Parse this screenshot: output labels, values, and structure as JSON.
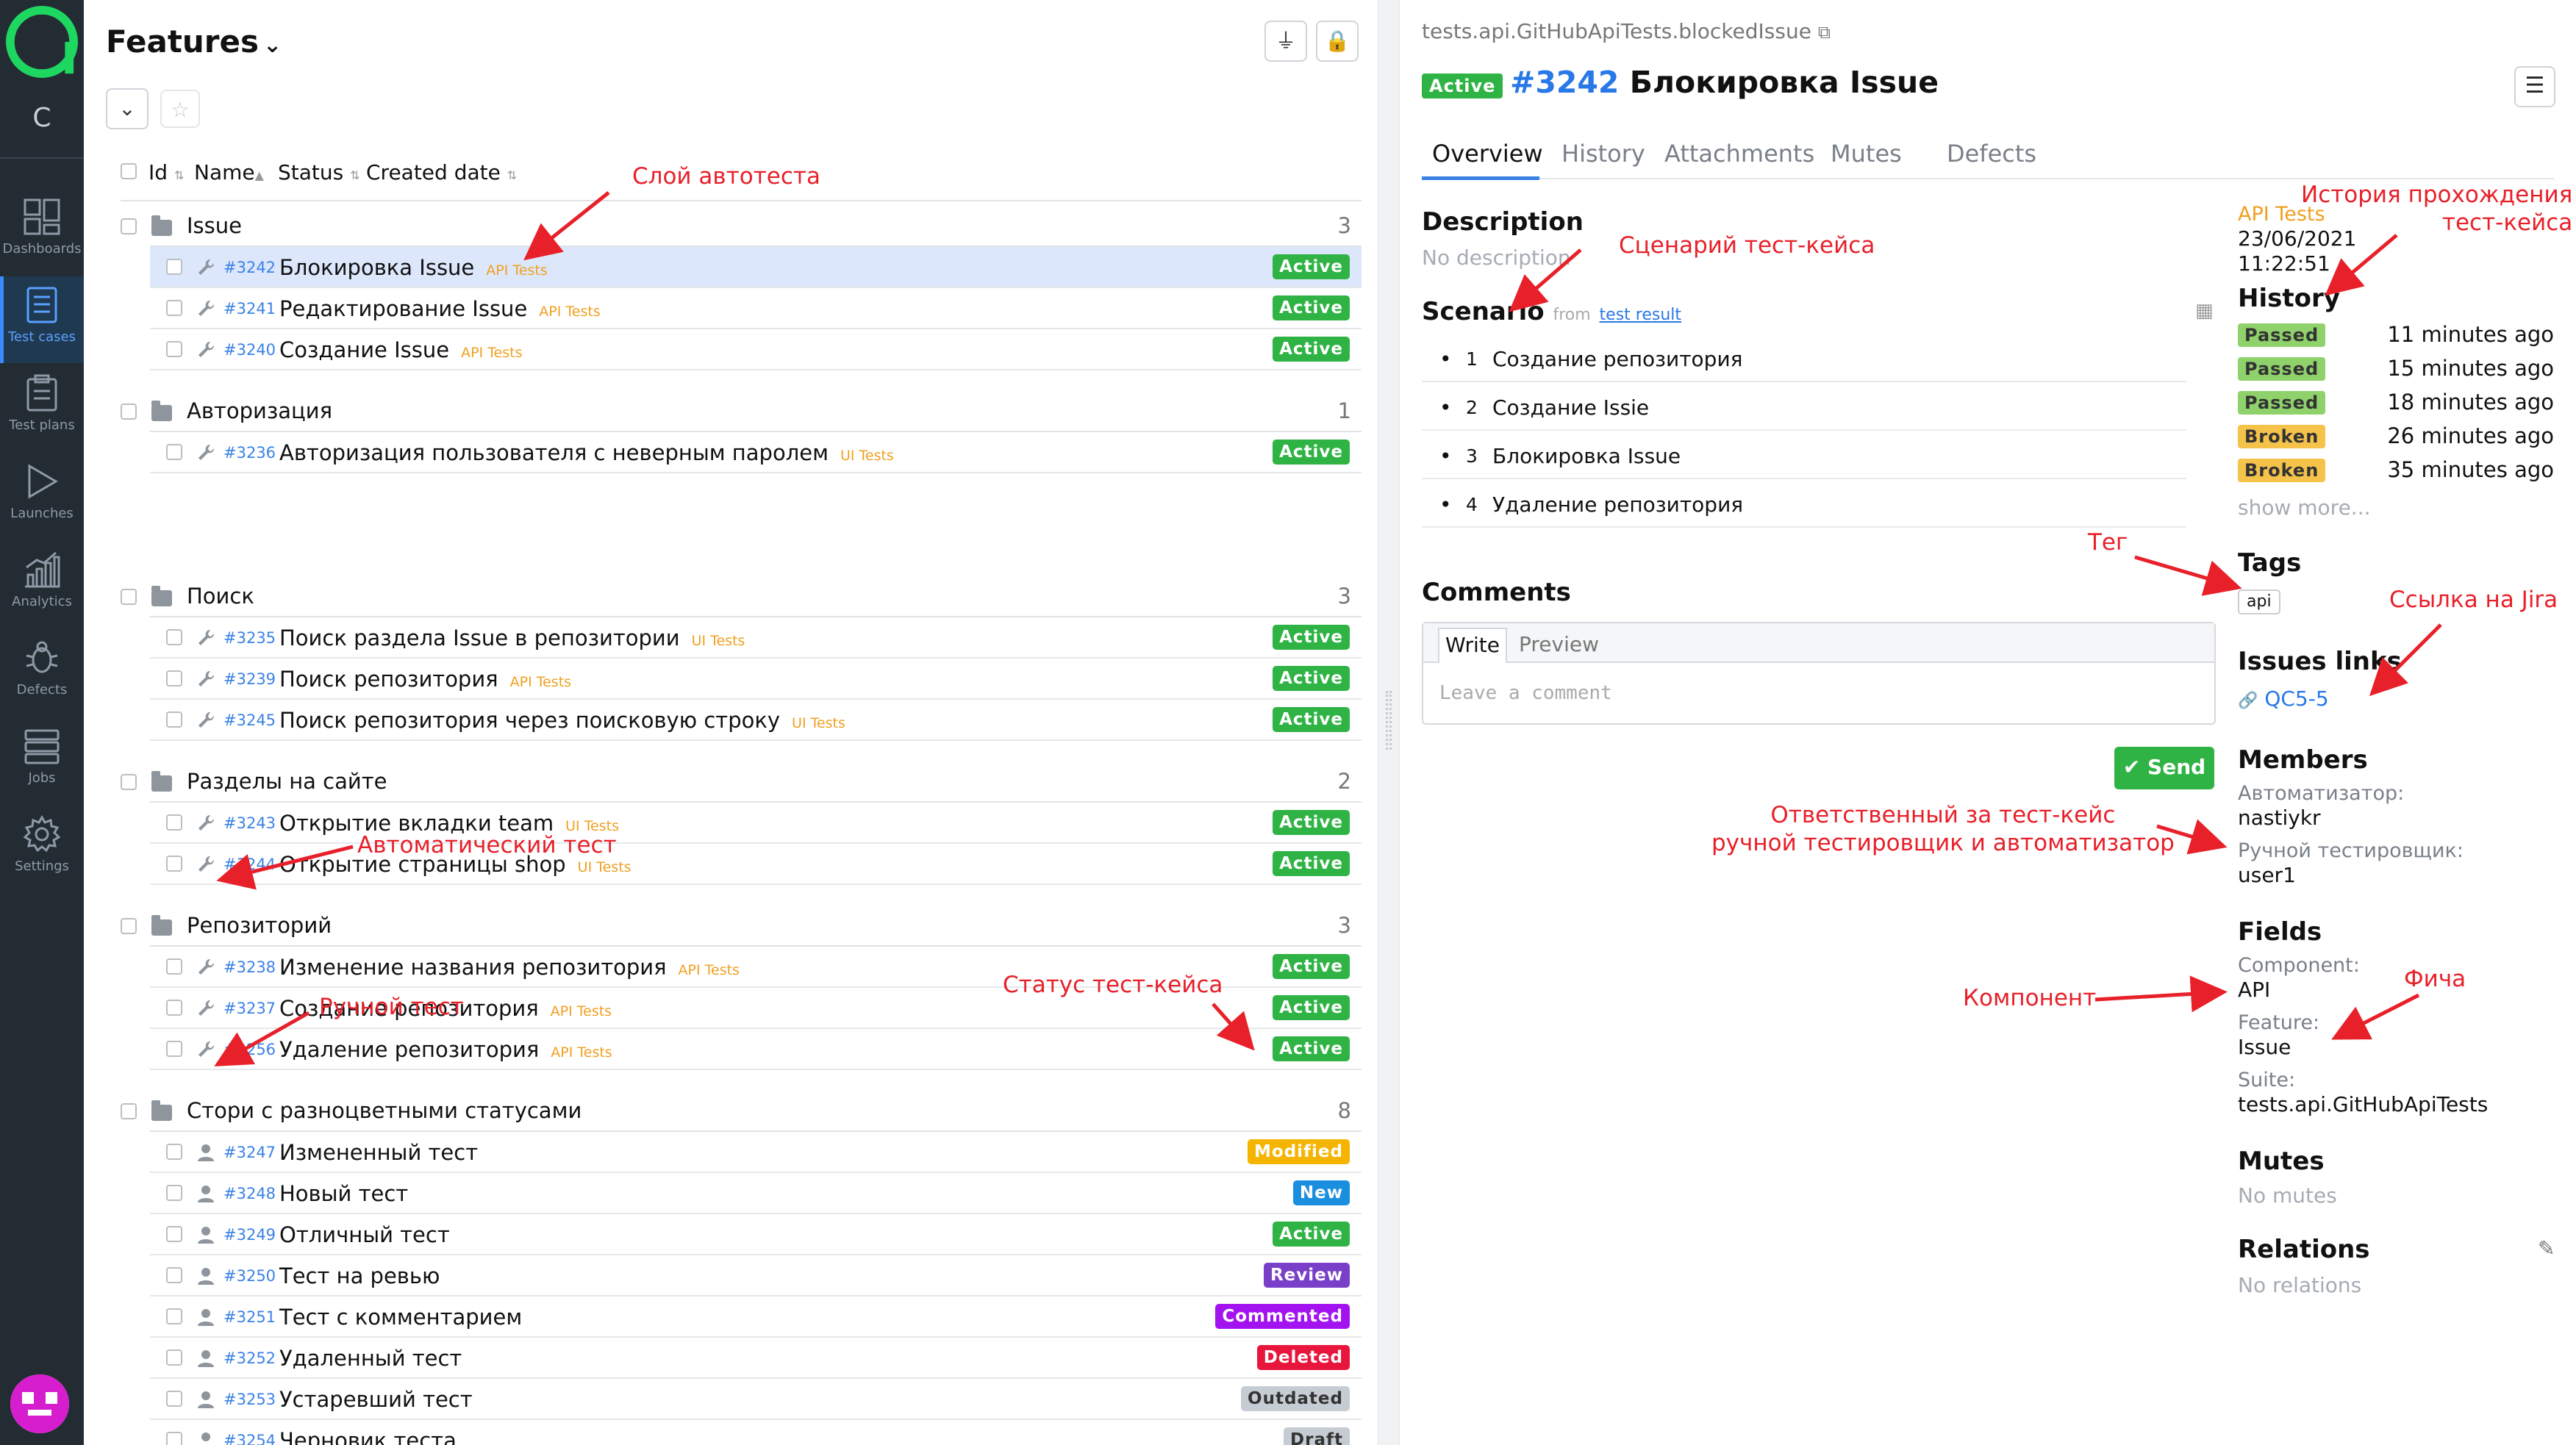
{
  "sidebar": {
    "project_letter": "C",
    "nav": [
      {
        "label": "Dashboards",
        "icon": "dashboards-icon",
        "active": false
      },
      {
        "label": "Test cases",
        "icon": "test-cases-icon",
        "active": true
      },
      {
        "label": "Test plans",
        "icon": "test-plans-icon",
        "active": false
      },
      {
        "label": "Launches",
        "icon": "launches-icon",
        "active": false
      },
      {
        "label": "Analytics",
        "icon": "analytics-icon",
        "active": false
      },
      {
        "label": "Defects",
        "icon": "defects-icon",
        "active": false
      },
      {
        "label": "Jobs",
        "icon": "jobs-icon",
        "active": false
      },
      {
        "label": "Settings",
        "icon": "settings-icon",
        "active": false
      }
    ]
  },
  "left": {
    "title": "Features",
    "columns": [
      "Id",
      "Name",
      "Status",
      "Created date"
    ],
    "groups": [
      {
        "name": "Issue",
        "count": "3",
        "rows": [
          {
            "id": "#3242",
            "name": "Блокировка Issue",
            "layer": "API Tests",
            "status": "Active",
            "type": "auto",
            "selected": true
          },
          {
            "id": "#3241",
            "name": "Редактирование Issue",
            "layer": "API Tests",
            "status": "Active",
            "type": "auto"
          },
          {
            "id": "#3240",
            "name": "Создание Issue",
            "layer": "API Tests",
            "status": "Active",
            "type": "auto"
          }
        ]
      },
      {
        "name": "Авторизация",
        "count": "1",
        "rows": [
          {
            "id": "#3236",
            "name": "Авторизация пользователя с неверным паролем",
            "layer": "UI Tests",
            "status": "Active",
            "type": "auto"
          }
        ]
      },
      {
        "name": "Поиск",
        "count": "3",
        "rows": [
          {
            "id": "#3235",
            "name": "Поиск раздела Issue в репозитории",
            "layer": "UI Tests",
            "status": "Active",
            "type": "auto"
          },
          {
            "id": "#3239",
            "name": "Поиск репозитория",
            "layer": "API Tests",
            "status": "Active",
            "type": "auto"
          },
          {
            "id": "#3245",
            "name": "Поиск репозитория через поисковую строку",
            "layer": "UI Tests",
            "status": "Active",
            "type": "auto"
          }
        ]
      },
      {
        "name": "Разделы на сайте",
        "count": "2",
        "rows": [
          {
            "id": "#3243",
            "name": "Открытие вкладки team",
            "layer": "UI Tests",
            "status": "Active",
            "type": "auto"
          },
          {
            "id": "#3244",
            "name": "Открытие страницы shop",
            "layer": "UI Tests",
            "status": "Active",
            "type": "auto"
          }
        ]
      },
      {
        "name": "Репозиторий",
        "count": "3",
        "rows": [
          {
            "id": "#3238",
            "name": "Изменение названия репозитория",
            "layer": "API Tests",
            "status": "Active",
            "type": "auto"
          },
          {
            "id": "#3237",
            "name": "Создание репозитория",
            "layer": "API Tests",
            "status": "Active",
            "type": "auto"
          },
          {
            "id": "#3256",
            "name": "Удаление репозитория",
            "layer": "API Tests",
            "status": "Active",
            "type": "auto"
          }
        ]
      },
      {
        "name": "Стори с разноцветными статусами",
        "count": "8",
        "rows": [
          {
            "id": "#3247",
            "name": "Измененный тест",
            "layer": "",
            "status": "Modified",
            "type": "manual"
          },
          {
            "id": "#3248",
            "name": "Новый тест",
            "layer": "",
            "status": "New",
            "type": "manual"
          },
          {
            "id": "#3249",
            "name": "Отличный тест",
            "layer": "",
            "status": "Active",
            "type": "manual"
          },
          {
            "id": "#3250",
            "name": "Тест на ревью",
            "layer": "",
            "status": "Review",
            "type": "manual"
          },
          {
            "id": "#3251",
            "name": "Тест с комментарием",
            "layer": "",
            "status": "Commented",
            "type": "manual"
          },
          {
            "id": "#3252",
            "name": "Удаленный тест",
            "layer": "",
            "status": "Deleted",
            "type": "manual"
          },
          {
            "id": "#3253",
            "name": "Устаревший тест",
            "layer": "",
            "status": "Outdated",
            "type": "manual"
          },
          {
            "id": "#3254",
            "name": "Черновик теста",
            "layer": "",
            "status": "Draft",
            "type": "manual"
          }
        ]
      }
    ]
  },
  "status_colors": {
    "Active": "#2fb344",
    "Modified": "#f5b400",
    "New": "#1a8fe0",
    "Review": "#7a3fc8",
    "Commented": "#a313f0",
    "Deleted": "#e8163c",
    "Outdated": "#c5ccd3",
    "Draft": "#c5ccd3"
  },
  "detail": {
    "full_name": "tests.api.GitHubApiTests.blockedIssue",
    "status": "Active",
    "id": "#3242",
    "name": "Блокировка Issue",
    "tabs": [
      "Overview",
      "History",
      "Attachments",
      "Mutes",
      "Defects"
    ],
    "description_title": "Description",
    "description_value": "No description",
    "scenario_title": "Scenario",
    "scenario_from": "from",
    "scenario_link": "test result",
    "steps": [
      {
        "num": "1",
        "text": "Создание репозитория"
      },
      {
        "num": "2",
        "text": "Создание Issie"
      },
      {
        "num": "3",
        "text": "Блокировка Issue"
      },
      {
        "num": "4",
        "text": "Удаление репозитория"
      }
    ],
    "comments_title": "Comments",
    "comment_write": "Write",
    "comment_preview": "Preview",
    "comment_placeholder": "Leave a comment",
    "send_label": "Send",
    "last_layer": "API Tests",
    "last_date": "23/06/2021",
    "last_time": "11:22:51",
    "history_title": "History",
    "history": [
      {
        "status": "Passed",
        "time": "11 minutes ago"
      },
      {
        "status": "Passed",
        "time": "15 minutes ago"
      },
      {
        "status": "Passed",
        "time": "18 minutes ago"
      },
      {
        "status": "Broken",
        "time": "26 minutes ago"
      },
      {
        "status": "Broken",
        "time": "35 minutes ago"
      }
    ],
    "show_more": "show more...",
    "tags_title": "Tags",
    "tag": "api",
    "issues_title": "Issues links",
    "issue": "QC5-5",
    "members_title": "Members",
    "automator_label": "Автоматизатор:",
    "automator_value": "nastiykr",
    "manual_label": "Ручной тестировщик:",
    "manual_value": "user1",
    "fields_title": "Fields",
    "component_label": "Component:",
    "component_value": "API",
    "feature_label": "Feature:",
    "feature_value": "Issue",
    "suite_label": "Suite:",
    "suite_value": "tests.api.GitHubApiTests",
    "mutes_title": "Mutes",
    "mutes_value": "No mutes",
    "relations_title": "Relations",
    "relations_value": "No relations"
  },
  "history_colors": {
    "Passed": "#8fd16a",
    "Broken": "#f5c24a"
  },
  "annotations": {
    "layer": "Слой автотеста",
    "scenario": "Сценарий тест-кейса",
    "history": "История прохождения\nтест-кейса",
    "auto": "Автоматический тест",
    "manual": "Ручной тест",
    "status": "Статус тест-кейса",
    "tag": "Тег",
    "jira": "Ссылка на Jira",
    "members": "Ответственный за тест-кейс\nручной тестировщик и автоматизатор",
    "component": "Компонент",
    "feature": "Фича"
  }
}
